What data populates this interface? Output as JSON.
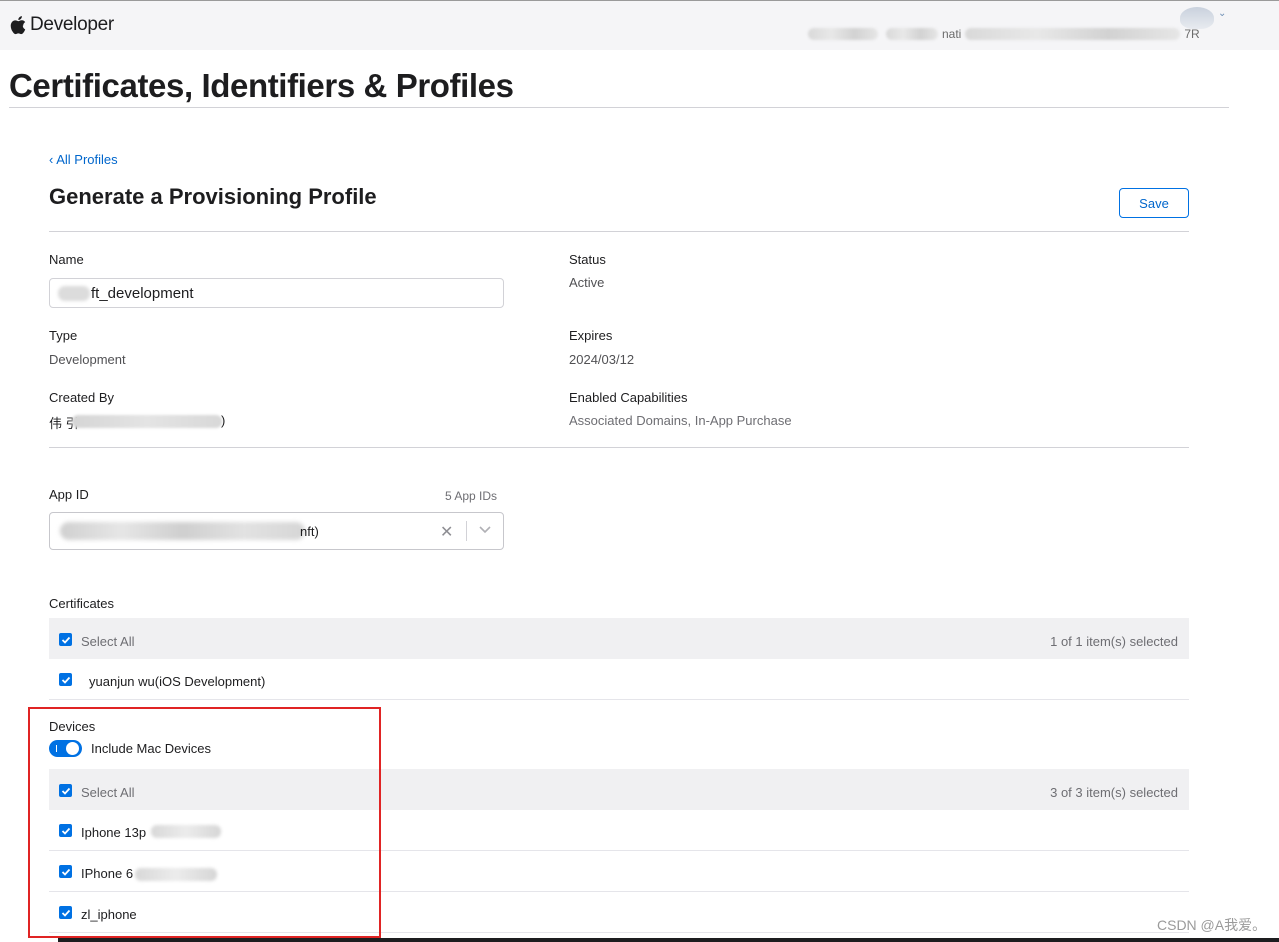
{
  "header": {
    "brand": "Developer",
    "team_fragment_1": "nati",
    "team_fragment_2": "7R",
    "account_chevron": "⌄"
  },
  "page": {
    "title": "Certificates, Identifiers & Profiles",
    "back_link": "‹ All Profiles",
    "section_title": "Generate a Provisioning Profile",
    "save_label": "Save"
  },
  "profile": {
    "name_label": "Name",
    "name_value": "ft_development",
    "status_label": "Status",
    "status_value": "Active",
    "type_label": "Type",
    "type_value": "Development",
    "expires_label": "Expires",
    "expires_value": "2024/03/12",
    "created_by_label": "Created By",
    "created_by_prefix": "伟 引",
    "created_by_suffix": ")",
    "capabilities_label": "Enabled Capabilities",
    "capabilities_value": "Associated Domains, In-App Purchase"
  },
  "app_id": {
    "label": "App ID",
    "count": "5 App IDs",
    "value_suffix": "nft)",
    "clear_symbol": "✕"
  },
  "certificates": {
    "label": "Certificates",
    "select_all": "Select All",
    "count": "1 of 1 item(s) selected",
    "items": [
      {
        "label": "yuanjun wu(iOS Development)",
        "checked": true
      }
    ]
  },
  "devices": {
    "label": "Devices",
    "include_mac_label": "Include Mac Devices",
    "include_mac_on": true,
    "select_all": "Select All",
    "count": "3 of 3 item(s) selected",
    "items": [
      {
        "label": "Iphone 13p",
        "checked": true
      },
      {
        "label": "IPhone 6",
        "checked": true
      },
      {
        "label": "zl_iphone",
        "checked": true
      }
    ]
  },
  "watermark": "CSDN @A我爱。",
  "colors": {
    "accent": "#0071e3",
    "link": "#0066cc",
    "highlight": "#e02424"
  }
}
